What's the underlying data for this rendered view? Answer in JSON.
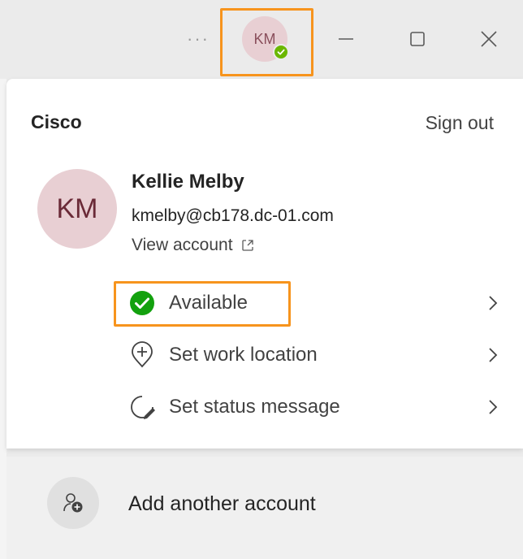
{
  "titlebar": {
    "more_label": "···",
    "avatar_initials": "KM"
  },
  "account": {
    "org": "Cisco",
    "sign_out": "Sign out",
    "initials": "KM",
    "name": "Kellie Melby",
    "email": "kmelby@cb178.dc-01.com",
    "view_account": "View account"
  },
  "menu": {
    "items": [
      {
        "label": "Available",
        "icon": "available-check-icon",
        "status_color": "#13a10e"
      },
      {
        "label": "Set work location",
        "icon": "location-pin-icon"
      },
      {
        "label": "Set status message",
        "icon": "status-message-icon"
      }
    ]
  },
  "footer": {
    "add_account": "Add another account"
  },
  "colors": {
    "highlight": "#f7941d",
    "presence_green": "#6bb700",
    "avatar_bg": "#e8cfd3"
  }
}
